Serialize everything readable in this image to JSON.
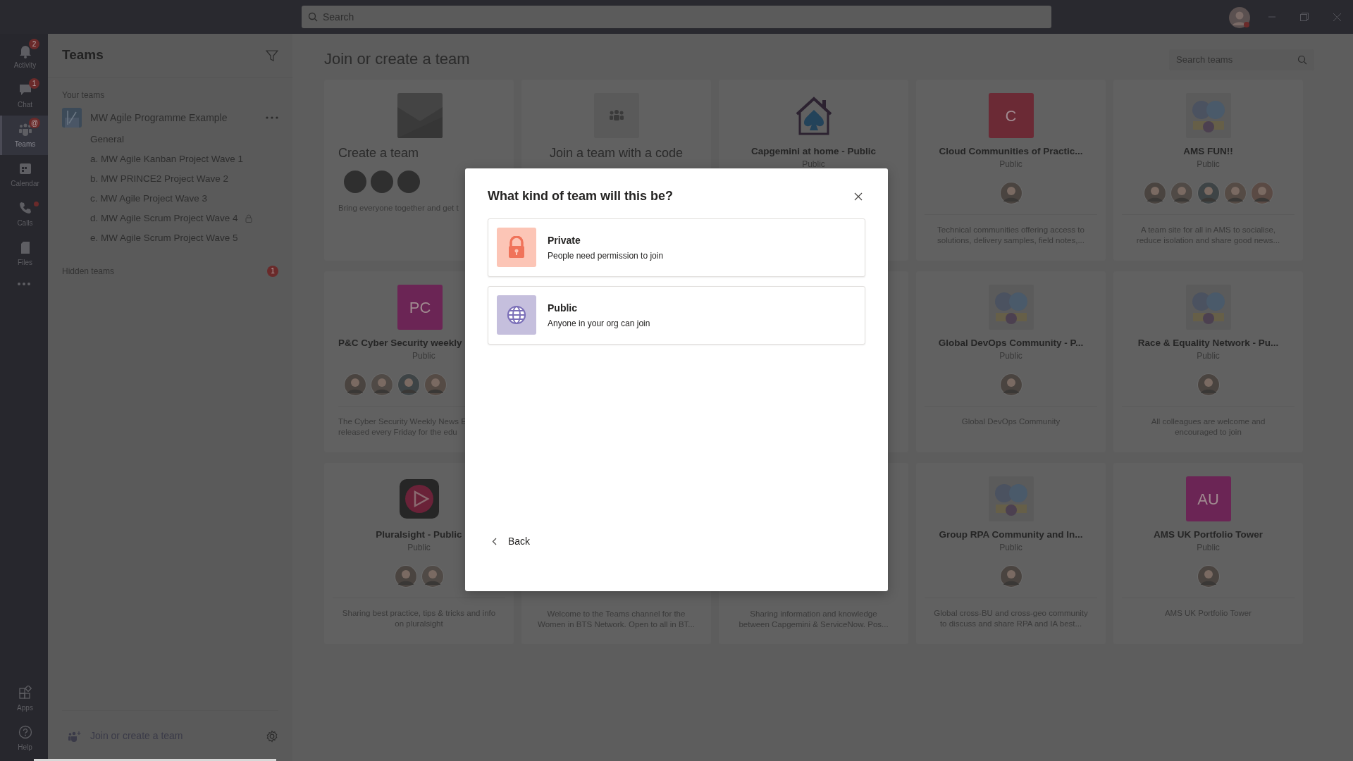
{
  "top_bar": {
    "search_placeholder": "Search"
  },
  "rail": {
    "items": [
      {
        "label": "Activity",
        "badge": "2",
        "dot": false,
        "selected": false
      },
      {
        "label": "Chat",
        "badge": "1",
        "dot": false,
        "selected": false
      },
      {
        "label": "Teams",
        "badge": "@",
        "dot": false,
        "selected": true
      },
      {
        "label": "Calendar",
        "dot": false,
        "selected": false
      },
      {
        "label": "Calls",
        "dot": true,
        "selected": false
      },
      {
        "label": "Files",
        "dot": false,
        "selected": false
      }
    ],
    "bottom_items": [
      {
        "label": "Apps"
      },
      {
        "label": "Help"
      }
    ]
  },
  "sidebar": {
    "title": "Teams",
    "section": "Your teams",
    "teams": [
      {
        "name": "MW Agile Programme Example",
        "channels": [
          {
            "name": "General",
            "locked": false
          },
          {
            "name": "a. MW Agile Kanban Project Wave 1",
            "locked": false
          },
          {
            "name": "b. MW PRINCE2 Project Wave 2",
            "locked": false
          },
          {
            "name": "c. MW Agile Project Wave 3",
            "locked": false
          },
          {
            "name": "d. MW Agile Scrum Project Wave 4",
            "locked": true
          },
          {
            "name": "e. MW Agile Scrum Project Wave 5",
            "locked": false
          }
        ]
      }
    ],
    "hidden_label": "Hidden teams",
    "hidden_count": "1",
    "footer": "Join or create a team"
  },
  "main": {
    "title": "Join or create a team",
    "search_placeholder": "Search teams",
    "cards": [
      {
        "logo": {
          "kind": "image-tile"
        },
        "title": "Create a team",
        "kind": "action",
        "cut_right": true,
        "avatars": [
          {
            "kind": "placeholder"
          },
          {
            "kind": "placeholder"
          },
          {
            "kind": "placeholder"
          }
        ],
        "description": [
          "Bring everyone together and get t"
        ]
      },
      {
        "logo": {
          "kind": "code"
        },
        "title": "Join a team with a code",
        "kind": "action",
        "cut_right": false
      },
      {
        "logo": {
          "kind": "house"
        },
        "title": "Capgemini at home - Public",
        "kind": "team",
        "privacy": "Public",
        "cut_right": false
      },
      {
        "logo": {
          "kind": "letters",
          "text": "C",
          "color": "#6b2a35"
        },
        "title": "Cloud Communities of Practic...",
        "kind": "team",
        "privacy": "Public",
        "cut_right": false,
        "avatars": [
          {
            "kind": "person"
          }
        ],
        "description": [
          "Technical communities offering access to",
          "solutions, delivery samples, field notes,..."
        ]
      },
      {
        "logo": {
          "kind": "picture"
        },
        "title": "AMS FUN!!",
        "kind": "team",
        "privacy": "Public",
        "cut_right": false,
        "avatars": [
          {
            "kind": "person"
          },
          {
            "kind": "person"
          },
          {
            "kind": "person"
          },
          {
            "kind": "person"
          },
          {
            "kind": "person"
          }
        ],
        "description": [
          "A team site for all in AMS to socialise,",
          "reduce isolation and share good news..."
        ]
      },
      {
        "logo": {
          "kind": "letters",
          "text": "PC",
          "color": "#6b2555"
        },
        "title": "P&C Cyber Security weekly",
        "kind": "team",
        "privacy": "Public",
        "cut_right": true,
        "avatars": [
          {
            "kind": "person"
          },
          {
            "kind": "person"
          },
          {
            "kind": "person"
          },
          {
            "kind": "person"
          }
        ],
        "description": [
          "The Cyber Security Weekly News E",
          "released every Friday for the edu"
        ]
      },
      {
        "kind": "covered"
      },
      {
        "kind": "hidden"
      },
      {
        "logo": {
          "kind": "picture"
        },
        "title": "Global DevOps Community - P...",
        "kind": "team",
        "privacy": "Public",
        "cut_right": false,
        "avatars": [
          {
            "kind": "person"
          }
        ],
        "description": [
          "Global DevOps Community"
        ]
      },
      {
        "logo": {
          "kind": "picture"
        },
        "title": "Race & Equality Network - Pu...",
        "kind": "team",
        "privacy": "Public",
        "cut_right": false,
        "avatars": [
          {
            "kind": "person"
          }
        ],
        "description": [
          "All colleagues are welcome and",
          "encouraged to join"
        ]
      },
      {
        "logo": {
          "kind": "play"
        },
        "title": "Pluralsight - Public",
        "kind": "team",
        "privacy": "Public",
        "cut_right": false,
        "avatars": [
          {
            "kind": "person"
          },
          {
            "kind": "person"
          }
        ],
        "description": [
          "Sharing best practice, tips & tricks and info",
          "on pluralsight"
        ]
      },
      {
        "kind": "hidden",
        "cut_right": false,
        "description": [
          "Welcome to the Teams channel for the",
          "Women in BTS Network. Open to all in BT..."
        ]
      },
      {
        "kind": "hidden",
        "cut_right": false,
        "description": [
          "Sharing information and knowledge",
          "between Capgemini & ServiceNow. Pos..."
        ]
      },
      {
        "logo": {
          "kind": "picture"
        },
        "title": "Group RPA Community and In...",
        "kind": "team",
        "privacy": "Public",
        "cut_right": false,
        "avatars": [
          {
            "kind": "person"
          }
        ],
        "description": [
          "Global cross-BU and cross-geo community",
          "to discuss and share RPA and IA best..."
        ]
      },
      {
        "logo": {
          "kind": "letters",
          "text": "AU",
          "color": "#6b2555"
        },
        "title": "AMS UK Portfolio Tower",
        "kind": "team",
        "privacy": "Public",
        "cut_right": false,
        "avatars": [
          {
            "kind": "person"
          }
        ],
        "description": [
          "AMS UK Portfolio Tower"
        ]
      }
    ]
  },
  "dialog": {
    "title": "What kind of team will this be?",
    "options": [
      {
        "kind": "private",
        "title": "Private",
        "subtitle": "People need permission to join"
      },
      {
        "kind": "public",
        "title": "Public",
        "subtitle": "Anyone in your org can join"
      }
    ],
    "back": "Back"
  }
}
